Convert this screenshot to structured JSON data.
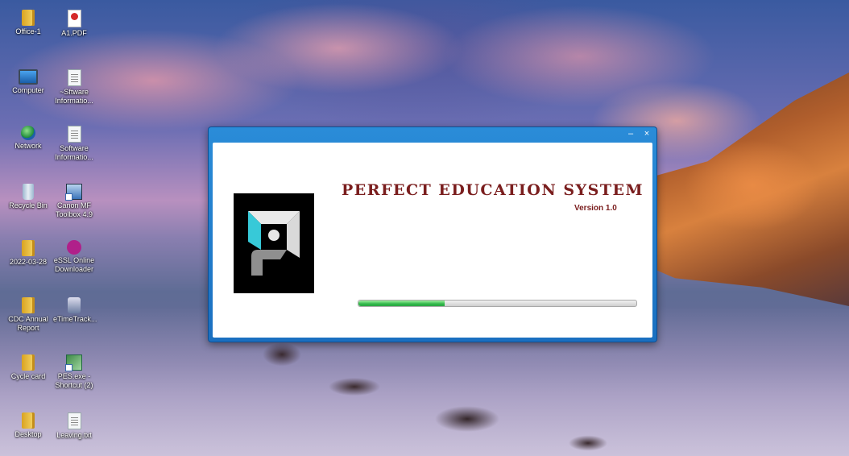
{
  "desktop": {
    "icons": [
      {
        "label": "Office-1",
        "icon": "folder-icon"
      },
      {
        "label": "A1.PDF",
        "icon": "pdf-file-icon"
      },
      {
        "label": "Computer",
        "icon": "computer-icon"
      },
      {
        "label": "~Sftware Informatio...",
        "icon": "document-icon"
      },
      {
        "label": "Network",
        "icon": "network-icon"
      },
      {
        "label": "Software Informatio...",
        "icon": "document-icon"
      },
      {
        "label": "Recycle Bin",
        "icon": "recycle-bin-icon"
      },
      {
        "label": "Canon MF Toolbox 4.9",
        "icon": "canon-shortcut-icon"
      },
      {
        "label": "2022-03-28",
        "icon": "folder-icon"
      },
      {
        "label": "eSSL Online Downloader",
        "icon": "essl-icon"
      },
      {
        "label": "CDC Annual Report",
        "icon": "folder-icon"
      },
      {
        "label": "eTimeTrack...",
        "icon": "etimetrack-icon"
      },
      {
        "label": "Cycle card",
        "icon": "folder-icon"
      },
      {
        "label": "PES.exe - Shortcut (2)",
        "icon": "pes-shortcut-icon"
      },
      {
        "label": "Desktop",
        "icon": "folder-icon"
      },
      {
        "label": "Leaving.txt",
        "icon": "text-file-icon"
      }
    ]
  },
  "splash": {
    "window_controls": {
      "minimize": "–",
      "close": "×"
    },
    "app_title": "PERFECT EDUCATION SYSTEM",
    "version": "Version 1.0",
    "progress_fraction": 0.31,
    "colors": {
      "title": "#7a1e1e",
      "progress": "#2aa542",
      "frame": "#1a6fc0"
    }
  }
}
